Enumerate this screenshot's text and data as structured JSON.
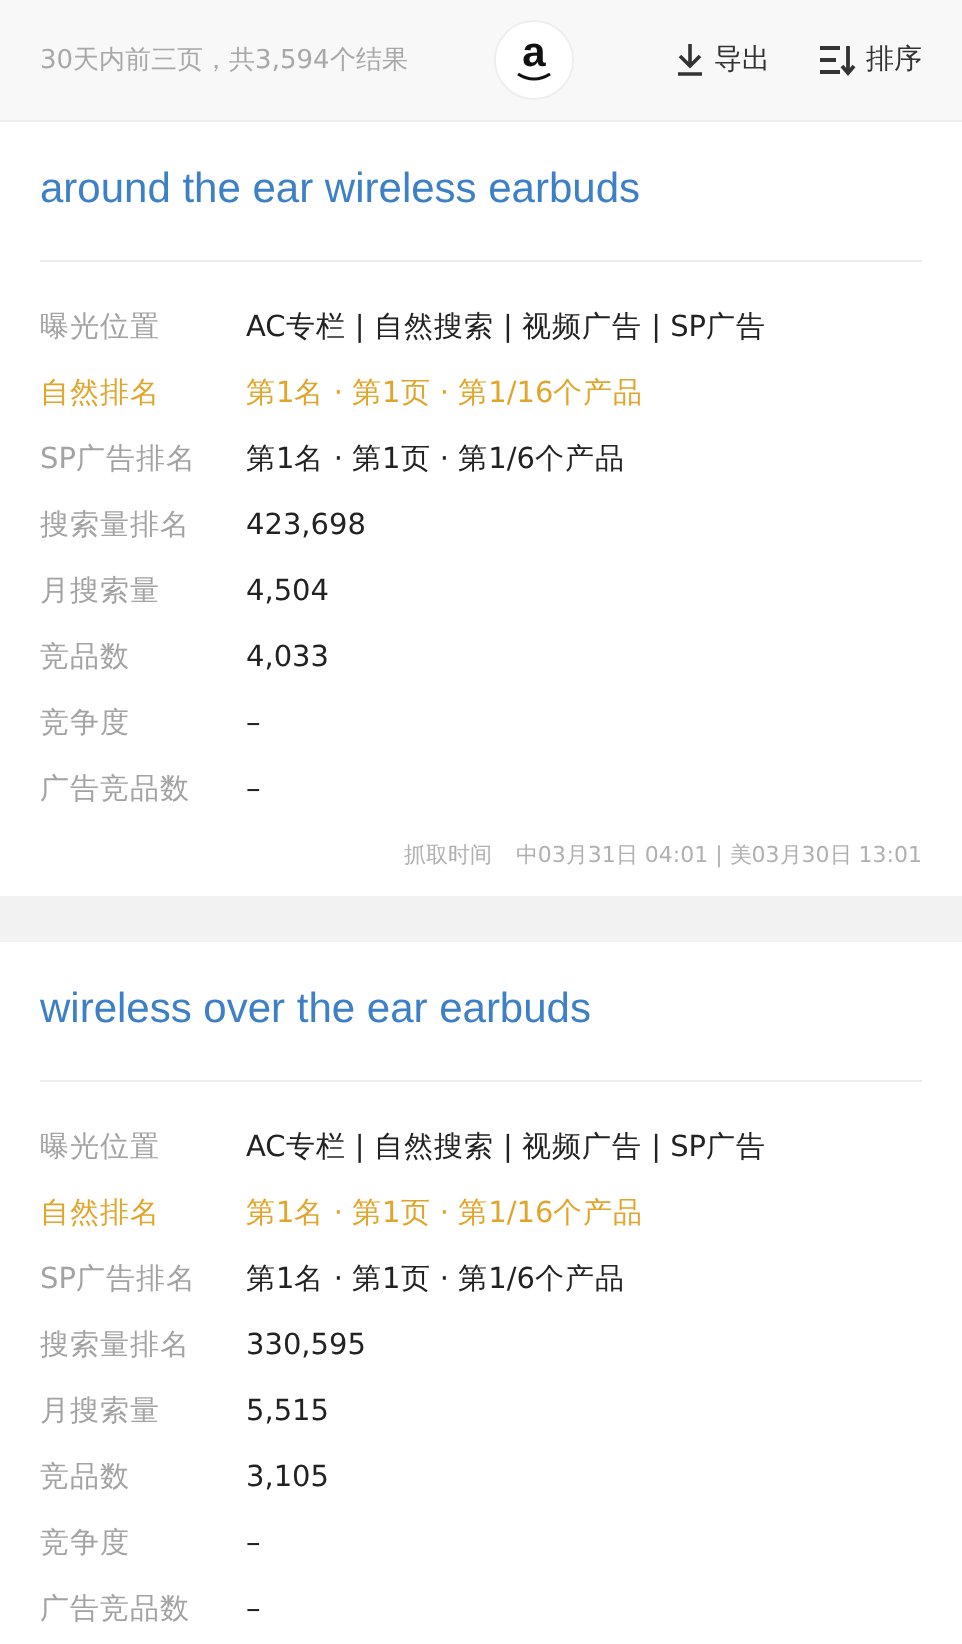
{
  "top_bar": {
    "summary": "30天内前三页，共3,594个结果",
    "store_logo": {
      "text": "a"
    },
    "actions": [
      {
        "kind": "export",
        "label": "导出"
      },
      {
        "kind": "sort",
        "label": "排序"
      }
    ]
  },
  "keywords": [
    {
      "title": "around the ear wireless earbuds",
      "rows": [
        {
          "label": "曝光位置",
          "value": "AC专栏 | 自然搜索 | 视频广告 | SP广告",
          "highlighted": false
        },
        {
          "label": "自然排名",
          "value": "第1名 · 第1页 · 第1/16个产品",
          "highlighted": true
        },
        {
          "label": "SP广告排名",
          "value": "第1名 · 第1页 · 第1/6个产品",
          "highlighted": false
        },
        {
          "label": "搜索量排名",
          "value": "423,698",
          "highlighted": false
        },
        {
          "label": "月搜索量",
          "value": "4,504",
          "highlighted": false
        },
        {
          "label": "竞品数",
          "value": "4,033",
          "highlighted": false
        },
        {
          "label": "竞争度",
          "value": "–",
          "highlighted": false
        },
        {
          "label": "广告竞品数",
          "value": "–",
          "highlighted": false
        }
      ],
      "fetch_time": {
        "label": "抓取时间",
        "value": "中03月31日 04:01 | 美03月30日 13:01"
      }
    },
    {
      "title": "wireless over the ear earbuds",
      "rows": [
        {
          "label": "曝光位置",
          "value": "AC专栏 | 自然搜索 | 视频广告 | SP广告",
          "highlighted": false
        },
        {
          "label": "自然排名",
          "value": "第1名 · 第1页 · 第1/16个产品",
          "highlighted": true
        },
        {
          "label": "SP广告排名",
          "value": "第1名 · 第1页 · 第1/6个产品",
          "highlighted": false
        },
        {
          "label": "搜索量排名",
          "value": "330,595",
          "highlighted": false
        },
        {
          "label": "月搜索量",
          "value": "5,515",
          "highlighted": false
        },
        {
          "label": "竞品数",
          "value": "3,105",
          "highlighted": false
        },
        {
          "label": "竞争度",
          "value": "–",
          "highlighted": false
        },
        {
          "label": "广告竞品数",
          "value": "–",
          "highlighted": false
        }
      ]
    }
  ]
}
